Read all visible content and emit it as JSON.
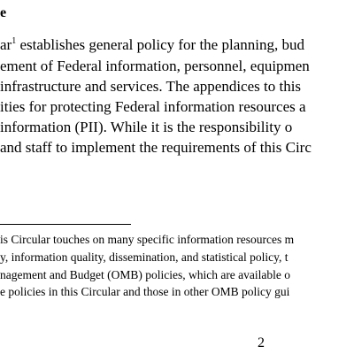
{
  "heading_fragment": "e",
  "body": {
    "line1_pre": "ar",
    "footnote_ref": "1",
    "line1_post": " establishes general policy for the planning, bud",
    "line2": "ement of Federal information, personnel, equipmen",
    "line3": "infrastructure and services.  The appendices to this",
    "line4": "ities for protecting Federal information resources a",
    "line5": " information (PII).  While it is the responsibility o",
    "line6": "and staff to implement the requirements of this Circ"
  },
  "footnote": {
    "line1": "is Circular touches on many specific information resources m",
    "line2": "y, information quality, dissemination, and statistical policy, t",
    "line3": "nagement and Budget (OMB) policies, which are available o",
    "line4": "e policies in this Circular and those in other OMB policy gui"
  },
  "page_number": "2"
}
